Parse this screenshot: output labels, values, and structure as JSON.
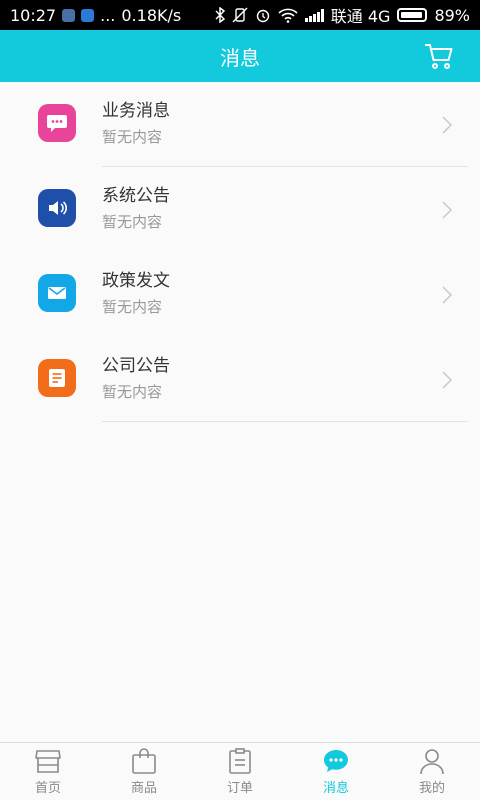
{
  "status_bar": {
    "time": "10:27",
    "dots": "...",
    "speed": "0.18K/s",
    "carrier": "联通 4G",
    "battery": "89%"
  },
  "header": {
    "title": "消息",
    "cart_icon": "cart-icon"
  },
  "messages": [
    {
      "title": "业务消息",
      "subtitle": "暂无内容",
      "icon": "chat-bubble-icon",
      "color": "#e8459a"
    },
    {
      "title": "系统公告",
      "subtitle": "暂无内容",
      "icon": "speaker-icon",
      "color": "#1f4fa8"
    },
    {
      "title": "政策发文",
      "subtitle": "暂无内容",
      "icon": "envelope-icon",
      "color": "#12a8e8"
    },
    {
      "title": "公司公告",
      "subtitle": "暂无内容",
      "icon": "document-icon",
      "color": "#f26c1a"
    }
  ],
  "tabs": [
    {
      "label": "首页",
      "icon": "store-icon",
      "active": false
    },
    {
      "label": "商品",
      "icon": "shopping-bag-icon",
      "active": false
    },
    {
      "label": "订单",
      "icon": "clipboard-icon",
      "active": false
    },
    {
      "label": "消息",
      "icon": "chat-bubble-icon",
      "active": true
    },
    {
      "label": "我的",
      "icon": "person-icon",
      "active": false
    }
  ],
  "colors": {
    "accent": "#13c9dc",
    "divider": "#e3e3e3",
    "muted_text": "#999999"
  }
}
